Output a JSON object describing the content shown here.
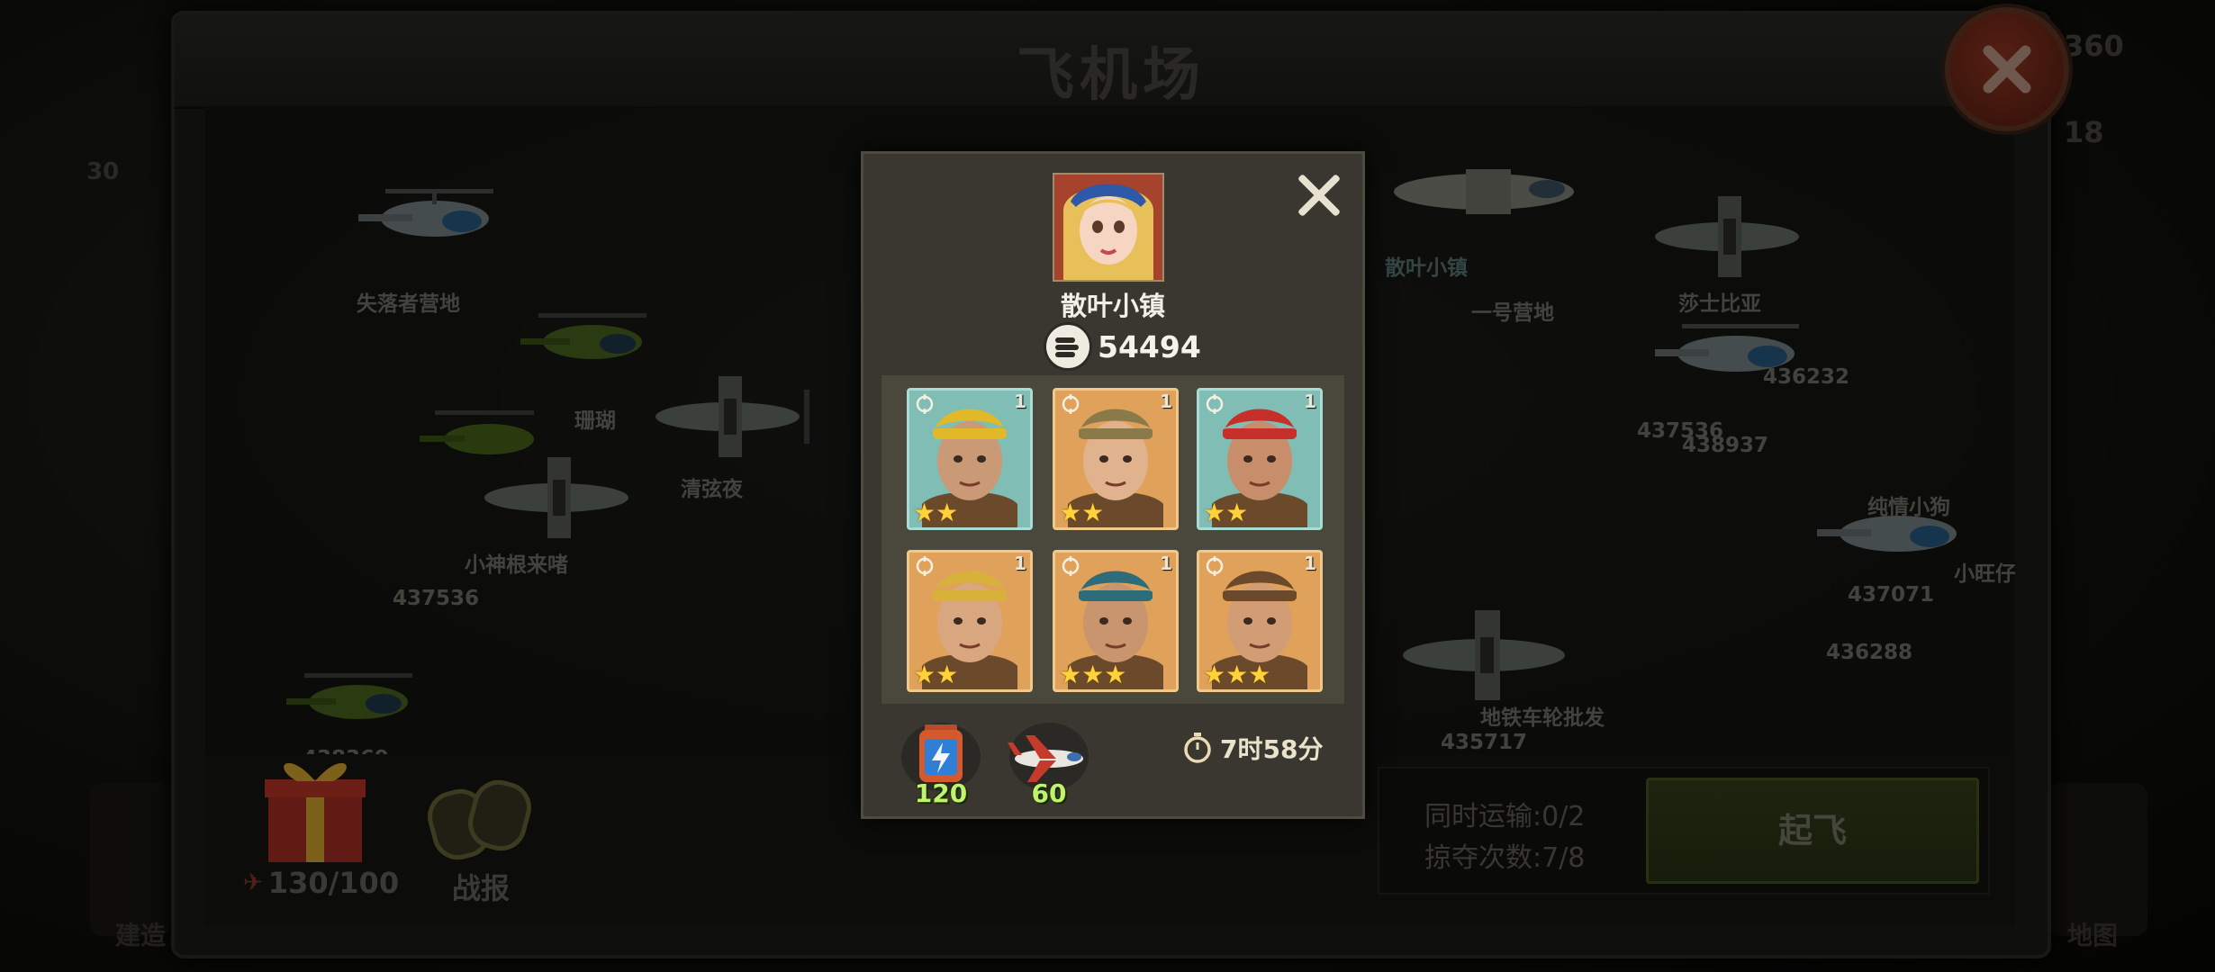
{
  "airport": {
    "title": "飞机场",
    "corner_number_top": "360",
    "corner_number_mid": "18",
    "left_badge": "30"
  },
  "map_labels": [
    "失落者营地",
    "珊瑚",
    "清弦夜",
    "小神根来啫",
    "437536",
    "438369",
    "散叶小镇",
    "一号营地",
    "莎士比亚",
    "436232",
    "437536",
    "438937",
    "纯情小狗",
    "小旺仔",
    "437071",
    "436288",
    "地铁车轮批发",
    "435717"
  ],
  "bottom": {
    "plane_count": "130/100",
    "report_label": "战报",
    "build_label": "建造",
    "map_label": "地图",
    "concurrent_transport": "同时运输:0/2",
    "raid_count": "掠夺次数:7/8",
    "takeoff_label": "起飞"
  },
  "modal": {
    "owner_name": "散叶小镇",
    "power": "54494",
    "heroes": [
      {
        "level": "1",
        "stars": 2,
        "badge": "flag-icon",
        "bg": "#7fbdb5"
      },
      {
        "level": "1",
        "stars": 2,
        "badge": "shield-icon",
        "bg": "#e0a25a"
      },
      {
        "level": "1",
        "stars": 2,
        "badge": "crosshair-icon",
        "bg": "#7fbdb5"
      },
      {
        "level": "1",
        "stars": 2,
        "badge": "crosshair-icon",
        "bg": "#e0a25a"
      },
      {
        "level": "1",
        "stars": 3,
        "badge": "crosshair-icon",
        "bg": "#e0a25a"
      },
      {
        "level": "1",
        "stars": 3,
        "badge": "crosshair-icon",
        "bg": "#e0a25a"
      }
    ],
    "resources": [
      {
        "icon": "battery-icon",
        "value": "120"
      },
      {
        "icon": "airplane-icon",
        "value": "60"
      }
    ],
    "timer": "7时58分"
  }
}
